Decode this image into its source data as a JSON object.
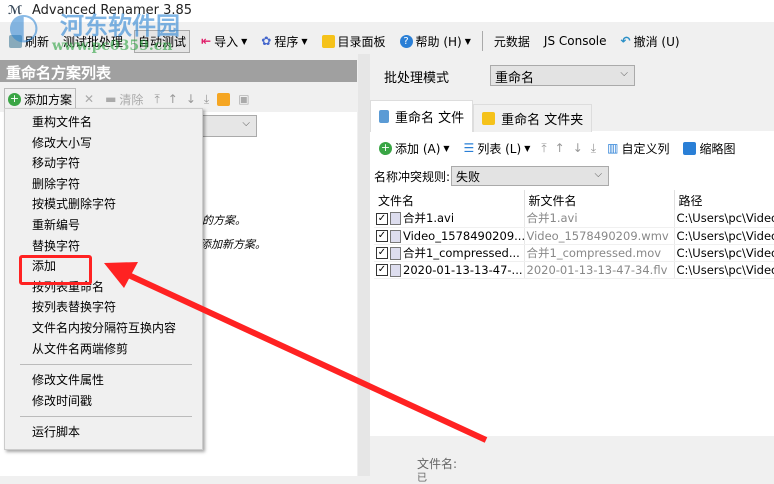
{
  "title": "Advanced Renamer 3.85",
  "watermark": {
    "name": "河东软件园",
    "url": "www.pc0359.cn"
  },
  "toolbar": {
    "refresh": "刷新",
    "test_batch": "测试批处理",
    "auto_test": "自动测试",
    "import": "导入",
    "program": "程序",
    "dir_panel": "目录面板",
    "help": "帮助 (H)",
    "metadata": "元数据",
    "js_console": "JS Console",
    "undo": "撤消 (U)"
  },
  "left": {
    "title": "重命名方案列表",
    "add_method": "添加方案",
    "clear": "清除",
    "hint1": "的方案。",
    "hint2": "添加新方案。"
  },
  "menu": {
    "items": [
      "重构文件名",
      "修改大小写",
      "移动字符",
      "删除字符",
      "按模式删除字符",
      "重新编号",
      "替换字符",
      "添加",
      "按列表重命名",
      "按列表替换字符",
      "文件名内按分隔符互换内容",
      "从文件名两端修剪"
    ],
    "items2": [
      "修改文件属性",
      "修改时间戳"
    ],
    "items3": [
      "运行脚本"
    ]
  },
  "right": {
    "mode_label": "批处理模式",
    "mode_value": "重命名",
    "tab_files": "重命名 文件",
    "tab_folders": "重命名 文件夹",
    "add": "添加 (A)",
    "list": "列表 (L)",
    "custom_cols": "自定义列",
    "thumbnails": "缩略图",
    "conflict_label": "名称冲突规则:",
    "conflict_value": "失败",
    "columns": [
      "文件名",
      "新文件名",
      "路径"
    ],
    "rows": [
      {
        "name": "合并1.avi",
        "new": "合并1.avi",
        "path": "C:\\Users\\pc\\Videos\\"
      },
      {
        "name": "Video_1578490209....",
        "new": "Video_1578490209.wmv",
        "path": "C:\\Users\\pc\\Videos\\"
      },
      {
        "name": "合并1_compressed...",
        "new": "合并1_compressed.mov",
        "path": "C:\\Users\\pc\\Videos\\"
      },
      {
        "name": "2020-01-13-13-47-...",
        "new": "2020-01-13-13-47-34.flv",
        "path": "C:\\Users\\pc\\Videos\\"
      }
    ],
    "bottom_label": "文件名:",
    "bottom_value": "已"
  },
  "colors": {
    "highlight": "#ff2222",
    "accent_green": "#3aa545",
    "header_gray": "#a0a0a0"
  }
}
